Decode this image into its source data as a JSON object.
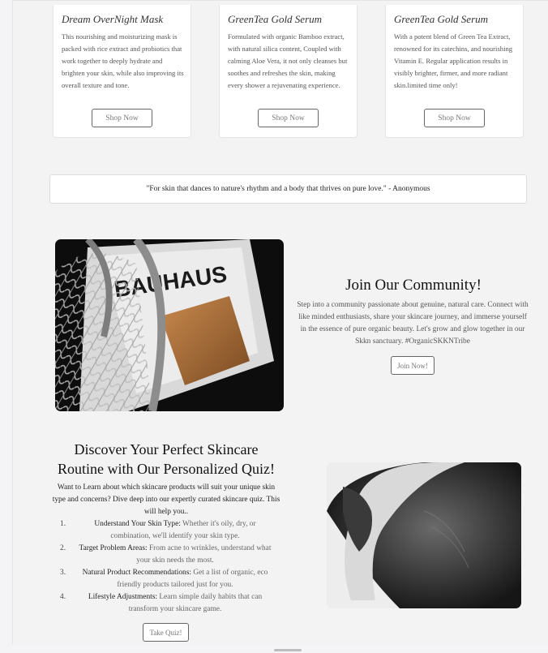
{
  "products": [
    {
      "title": "Dream OverNight Mask",
      "description": "This nourishing and moisturizing mask is packed with rice extract and probiotics that work together to deeply hydrate and brighten your skin, while also improving its overall texture and tone.",
      "button": "Shop Now"
    },
    {
      "title": "GreenTea Gold Serum",
      "description": "Formulated with organic Bamboo extract, with natural silica content, Coupled with calming Aloe Vera, it not only cleanses but soothes and refreshes the skin, making every shower a rejuvenating experience.",
      "button": "Shop Now"
    },
    {
      "title": "GreenTea Gold Serum",
      "description": "With a potent blend of Green Tea Extract, renowned for its catechins, and nourishing Vitamin E. Regular application results in visibly brighter, firmer, and more radiant skin.limited time only!",
      "button": "Shop Now"
    }
  ],
  "quote": "\"For skin that dances to nature's rhythm and a body that thrives on pure love.\" - Anonymous",
  "community": {
    "image_text": "BAUHAUS",
    "title": "Join Our Community!",
    "text": "Step into a community passionate about genuine, natural care. Connect with like minded enthusiasts, share your skincare journey, and immerse yourself in the essence of pure organic beauty. Let's grow and glow together in our Skkn sanctuary. #OrganicSKKNTribe",
    "button": "Join Now!"
  },
  "quiz": {
    "title_line1": "Discover Your Perfect Skincare",
    "title_line2": "Routine with Our Personalized Quiz!",
    "intro": "Want to Learn about which skincare products will suit your unique skin type and concerns? Dive deep into our expertly curated skincare quiz. This will help you..",
    "items": [
      {
        "num": "1.",
        "label": "Understand Your Skin Type:",
        "text": " Whether it's oily, dry, or combination, we'll identify your skin type."
      },
      {
        "num": "2.",
        "label": "Target Problem Areas:",
        "text": " From acne to wrinkles, understand what your skin needs the most."
      },
      {
        "num": "3.",
        "label": "Natural Product Recommendations:",
        "text": " Get a list of organic, eco friendly products tailored just for you."
      },
      {
        "num": "4.",
        "label": "Lifestyle Adjustments:",
        "text": " Learn simple daily habits that can transform your skincare game."
      }
    ],
    "button": "Take Quiz!"
  }
}
